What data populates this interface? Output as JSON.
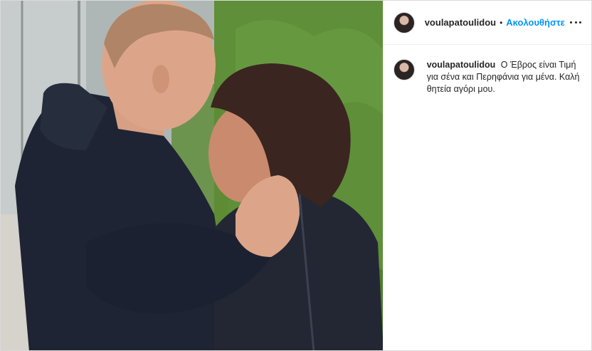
{
  "post": {
    "username": "voulapatoulidou",
    "separator": "•",
    "follow_label": "Ακολουθήστε",
    "more_icon": "more-options-icon",
    "caption": {
      "username": "voulapatoulidou",
      "text": "Ο Έβρος είναι Τιμή για σένα και Περηφάνια για μένα. Καλή θητεία αγόρι μου."
    }
  },
  "photo": {
    "description_icon": "photo",
    "colors": {
      "hedge": "#4f7d2f",
      "hoodie": "#1e2433",
      "skin": "#dca58a",
      "hair_woman": "#3a2520",
      "hair_man": "#b08466",
      "building": "#b9c0bf"
    }
  }
}
